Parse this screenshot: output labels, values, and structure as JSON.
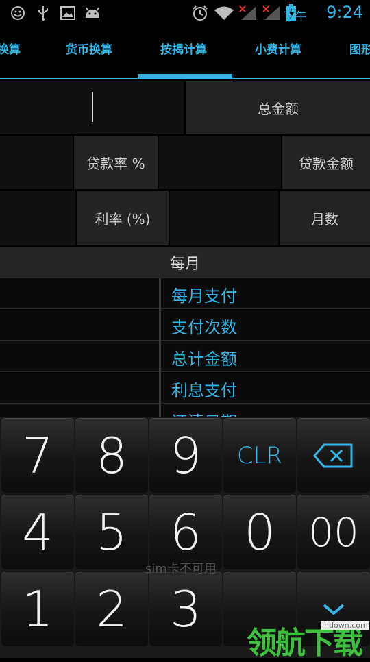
{
  "status_bar": {
    "ampm": "下午",
    "time": "9:24",
    "icons": [
      "smiley-icon",
      "usb-icon",
      "image-icon",
      "android-icon",
      "alarm-icon",
      "wifi-icon",
      "signal-icon",
      "signal-icon-2",
      "battery-icon"
    ]
  },
  "tabs": [
    {
      "label": "换算"
    },
    {
      "label": "货币换算"
    },
    {
      "label": "按揭计算"
    },
    {
      "label": "小费计算"
    },
    {
      "label": "图形"
    }
  ],
  "form": {
    "total_amount_label": "总金额",
    "loan_rate_label": "贷款率 %",
    "loan_amount_label": "贷款金额",
    "interest_rate_label": "利率 (%)",
    "months_label": "月数"
  },
  "section_title": "每月",
  "results": [
    {
      "label": "每月支付"
    },
    {
      "label": "支付次数"
    },
    {
      "label": "总计金额"
    },
    {
      "label": "利息支付"
    },
    {
      "label": "还清日期"
    }
  ],
  "keypad": {
    "keys": [
      "7",
      "8",
      "9",
      "CLR",
      "4",
      "5",
      "6",
      "0",
      "00",
      "1",
      "2",
      "3"
    ]
  },
  "overlay": {
    "sim_text": "sim卡不可用",
    "watermark": "领航下载",
    "watermark_site": "lhdown.com"
  },
  "colors": {
    "accent": "#33b5e5",
    "background": "#000000",
    "watermark": "#3fbf3f"
  }
}
